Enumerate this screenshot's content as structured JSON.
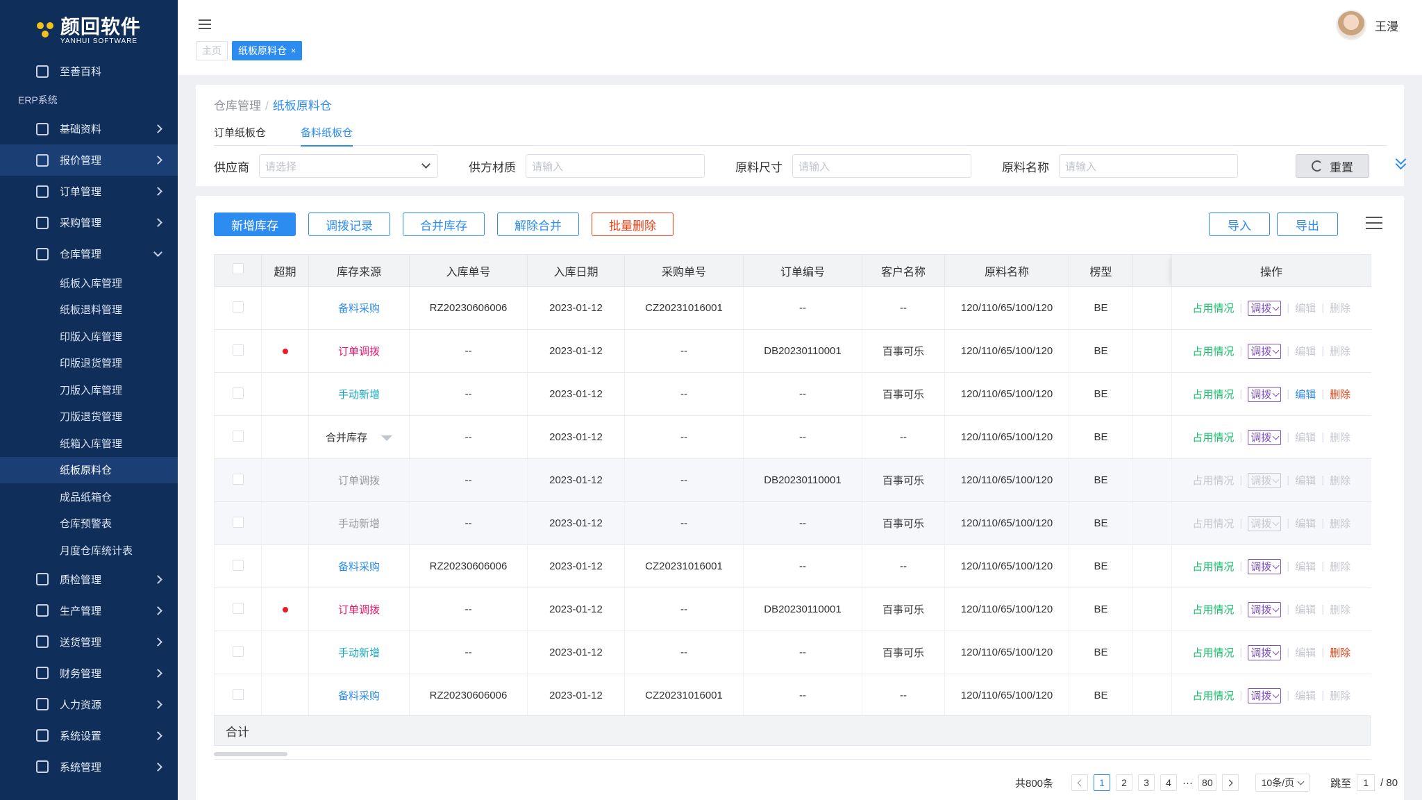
{
  "logo": {
    "cn": "颜回软件",
    "en": "YANHUI SOFTWARE"
  },
  "sidebar": {
    "top_item": "至善百科",
    "section": "ERP系统",
    "items_before": [
      {
        "label": "基础资料",
        "icon": "database-icon"
      },
      {
        "label": "报价管理",
        "icon": "yen-icon"
      },
      {
        "label": "订单管理",
        "icon": "clipboard-icon"
      },
      {
        "label": "采购管理",
        "icon": "cart-icon"
      }
    ],
    "warehouse": {
      "label": "仓库管理",
      "children": [
        "纸板入库管理",
        "纸板退料管理",
        "印版入库管理",
        "印版退货管理",
        "刀版入库管理",
        "刀版退货管理",
        "纸箱入库管理",
        "纸板原料仓",
        "成品纸箱仓",
        "仓库预警表",
        "月度仓库统计表"
      ]
    },
    "items_after": [
      {
        "label": "质检管理",
        "icon": "shield-icon"
      },
      {
        "label": "生产管理",
        "icon": "factory-icon"
      },
      {
        "label": "送货管理",
        "icon": "box-icon"
      },
      {
        "label": "财务管理",
        "icon": "finance-icon"
      },
      {
        "label": "人力资源",
        "icon": "person-icon"
      },
      {
        "label": "系统设置",
        "icon": "gear-icon"
      },
      {
        "label": "系统管理",
        "icon": "grid-icon"
      }
    ]
  },
  "topbar": {
    "tags": [
      {
        "label": "主页"
      },
      {
        "label": "纸板原料仓",
        "close": "×"
      }
    ],
    "user_name": "王漫"
  },
  "breadcrumb": {
    "parent": "仓库管理",
    "sep": "/",
    "current": "纸板原料仓"
  },
  "subtabs": [
    "订单纸板仓",
    "备料纸板仓"
  ],
  "filters": {
    "supplier": {
      "label": "供应商",
      "placeholder": "请选择"
    },
    "material": {
      "label": "供方材质",
      "placeholder": "请输入"
    },
    "size": {
      "label": "原料尺寸",
      "placeholder": "请输入"
    },
    "name": {
      "label": "原料名称",
      "placeholder": "请输入"
    },
    "reset": "重置"
  },
  "toolbar": {
    "add": "新增库存",
    "transfer_log": "调拨记录",
    "merge": "合并库存",
    "unmerge": "解除合并",
    "batch_delete": "批量删除",
    "import": "导入",
    "export": "导出"
  },
  "table": {
    "headers": [
      "超期",
      "库存来源",
      "入库单号",
      "入库日期",
      "采购单号",
      "订单编号",
      "客户名称",
      "原料名称",
      "楞型",
      "",
      "操作"
    ],
    "ops": {
      "occupy": "占用情况",
      "transfer": "调拨",
      "edit": "编辑",
      "delete": "删除"
    },
    "rows": [
      {
        "overdue": false,
        "source": "备料采购",
        "src_color": "blue",
        "in_no": "RZ20230606006",
        "in_date": "2023-01-12",
        "po_no": "CZ20231016001",
        "order_no": "--",
        "customer": "--",
        "material": "120/110/65/100/120",
        "flute": "BE",
        "dim": false,
        "edit_on": false,
        "del_on": false
      },
      {
        "overdue": true,
        "source": "订单调拨",
        "src_color": "red",
        "in_no": "--",
        "in_date": "2023-01-12",
        "po_no": "--",
        "order_no": "DB20230110001",
        "customer": "百事可乐",
        "material": "120/110/65/100/120",
        "flute": "BE",
        "dim": false,
        "edit_on": false,
        "del_on": false
      },
      {
        "overdue": false,
        "source": "手动新增",
        "src_color": "cyan",
        "in_no": "--",
        "in_date": "2023-01-12",
        "po_no": "--",
        "order_no": "--",
        "customer": "百事可乐",
        "material": "120/110/65/100/120",
        "flute": "BE",
        "dim": false,
        "edit_on": true,
        "del_on": true
      },
      {
        "overdue": false,
        "source": "合并库存",
        "src_color": "dark",
        "merge": true,
        "in_no": "--",
        "in_date": "2023-01-12",
        "po_no": "--",
        "order_no": "--",
        "customer": "--",
        "material": "120/110/65/100/120",
        "flute": "BE",
        "dim": false,
        "edit_on": false,
        "del_on": false
      },
      {
        "overdue": false,
        "source": "订单调拨",
        "src_color": "gray",
        "in_no": "--",
        "in_date": "2023-01-12",
        "po_no": "--",
        "order_no": "DB20230110001",
        "customer": "百事可乐",
        "material": "120/110/65/100/120",
        "flute": "BE",
        "dim": true,
        "edit_on": false,
        "del_on": false
      },
      {
        "overdue": false,
        "source": "手动新增",
        "src_color": "gray",
        "in_no": "--",
        "in_date": "2023-01-12",
        "po_no": "--",
        "order_no": "--",
        "customer": "百事可乐",
        "material": "120/110/65/100/120",
        "flute": "BE",
        "dim": true,
        "edit_on": false,
        "del_on": false
      },
      {
        "overdue": false,
        "source": "备料采购",
        "src_color": "blue",
        "in_no": "RZ20230606006",
        "in_date": "2023-01-12",
        "po_no": "CZ20231016001",
        "order_no": "--",
        "customer": "--",
        "material": "120/110/65/100/120",
        "flute": "BE",
        "dim": false,
        "edit_on": false,
        "del_on": false
      },
      {
        "overdue": true,
        "source": "订单调拨",
        "src_color": "red",
        "in_no": "--",
        "in_date": "2023-01-12",
        "po_no": "--",
        "order_no": "DB20230110001",
        "customer": "百事可乐",
        "material": "120/110/65/100/120",
        "flute": "BE",
        "dim": false,
        "edit_on": false,
        "del_on": false
      },
      {
        "overdue": false,
        "source": "手动新增",
        "src_color": "cyan",
        "in_no": "--",
        "in_date": "2023-01-12",
        "po_no": "--",
        "order_no": "--",
        "customer": "百事可乐",
        "material": "120/110/65/100/120",
        "flute": "BE",
        "dim": false,
        "edit_on": false,
        "del_on": true
      },
      {
        "overdue": false,
        "source": "备料采购",
        "src_color": "blue",
        "in_no": "RZ20230606006",
        "in_date": "2023-01-12",
        "po_no": "CZ20231016001",
        "order_no": "--",
        "customer": "--",
        "material": "120/110/65/100/120",
        "flute": "BE",
        "dim": false,
        "edit_on": false,
        "del_on": false
      }
    ],
    "total_label": "合计"
  },
  "pagination": {
    "total": "共800条",
    "pages": [
      "1",
      "2",
      "3",
      "4"
    ],
    "ellipsis": "···",
    "last": "80",
    "page_size": "10条/页",
    "jump_label": "跳至",
    "jump_value": "1",
    "jump_total": "/ 80"
  },
  "colors": {
    "sidebar_bg": "#0f2e5a",
    "primary": "#2d8cf0",
    "danger": "#ed4014",
    "success": "#19be6b",
    "purple": "#7b50c7"
  }
}
